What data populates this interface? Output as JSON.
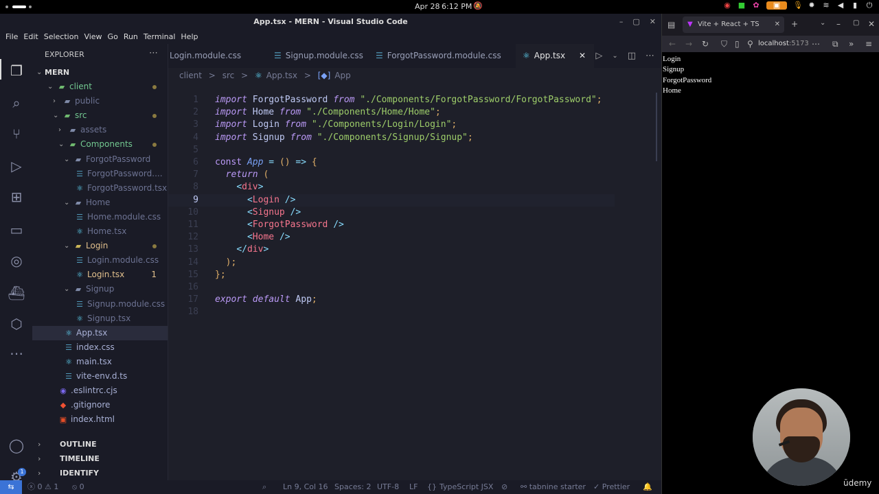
{
  "system": {
    "date": "Apr 28",
    "time": "6:12 PM"
  },
  "vscode": {
    "title": "App.tsx - MERN - Visual Studio Code",
    "menu": [
      "File",
      "Edit",
      "Selection",
      "View",
      "Go",
      "Run",
      "Terminal",
      "Help"
    ],
    "explorer": {
      "title": "EXPLORER",
      "root": "MERN",
      "tree": [
        {
          "label": "client",
          "depth": 1,
          "kind": "folder-open",
          "mod": "dot",
          "color": "green"
        },
        {
          "label": "public",
          "depth": 2,
          "kind": "folder",
          "mod": "",
          "color": "dim"
        },
        {
          "label": "src",
          "depth": 2,
          "kind": "folder-open",
          "mod": "dot",
          "color": "green"
        },
        {
          "label": "assets",
          "depth": 3,
          "kind": "folder",
          "mod": "",
          "color": "dim"
        },
        {
          "label": "Components",
          "depth": 3,
          "kind": "folder-open",
          "mod": "dot",
          "color": "green"
        },
        {
          "label": "ForgotPassword",
          "depth": 4,
          "kind": "folder-open",
          "mod": "",
          "color": "dim"
        },
        {
          "label": "ForgotPassword....",
          "depth": 5,
          "kind": "css",
          "mod": "",
          "color": "dim"
        },
        {
          "label": "ForgotPassword.tsx",
          "depth": 5,
          "kind": "react",
          "mod": "",
          "color": "dim"
        },
        {
          "label": "Home",
          "depth": 4,
          "kind": "folder-open",
          "mod": "",
          "color": "dim"
        },
        {
          "label": "Home.module.css",
          "depth": 5,
          "kind": "css",
          "mod": "",
          "color": "dim"
        },
        {
          "label": "Home.tsx",
          "depth": 5,
          "kind": "react",
          "mod": "",
          "color": "dim"
        },
        {
          "label": "Login",
          "depth": 4,
          "kind": "folder-open",
          "mod": "dot",
          "color": "yellow"
        },
        {
          "label": "Login.module.css",
          "depth": 5,
          "kind": "css",
          "mod": "",
          "color": "dim"
        },
        {
          "label": "Login.tsx",
          "depth": 5,
          "kind": "react",
          "mod": "1",
          "color": "yellow"
        },
        {
          "label": "Signup",
          "depth": 4,
          "kind": "folder-open",
          "mod": "",
          "color": "dim"
        },
        {
          "label": "Signup.module.css",
          "depth": 5,
          "kind": "css",
          "mod": "",
          "color": "dim"
        },
        {
          "label": "Signup.tsx",
          "depth": 5,
          "kind": "react",
          "mod": "",
          "color": "dim"
        },
        {
          "label": "App.tsx",
          "depth": 3,
          "kind": "react",
          "mod": "",
          "color": "normal",
          "selected": true
        },
        {
          "label": "index.css",
          "depth": 3,
          "kind": "css",
          "mod": "",
          "color": "normal"
        },
        {
          "label": "main.tsx",
          "depth": 3,
          "kind": "react",
          "mod": "",
          "color": "normal"
        },
        {
          "label": "vite-env.d.ts",
          "depth": 3,
          "kind": "ts",
          "mod": "",
          "color": "normal"
        },
        {
          "label": ".eslintrc.cjs",
          "depth": 2,
          "kind": "eslint",
          "mod": "",
          "color": "normal"
        },
        {
          "label": ".gitignore",
          "depth": 2,
          "kind": "git",
          "mod": "",
          "color": "normal"
        },
        {
          "label": "index.html",
          "depth": 2,
          "kind": "html",
          "mod": "",
          "color": "normal"
        }
      ],
      "sections": [
        "OUTLINE",
        "TIMELINE",
        "IDENTIFY"
      ]
    },
    "tabs": [
      {
        "label": "Login.module.css",
        "active": false
      },
      {
        "label": "Signup.module.css",
        "active": false
      },
      {
        "label": "ForgotPassword.module.css",
        "active": false
      },
      {
        "label": "App.tsx",
        "active": true
      }
    ],
    "breadcrumb": [
      "client",
      ">",
      "src",
      ">",
      "App.tsx",
      ">",
      "App"
    ],
    "code": [
      "import ForgotPassword from \"./Components/ForgotPassword/ForgotPassword\";",
      "import Home from \"./Components/Home/Home\";",
      "import Login from \"./Components/Login/Login\";",
      "import Signup from \"./Components/Signup/Signup\";",
      "",
      "const App = () => {",
      "  return (",
      "    <div>",
      "      <Login />",
      "      <Signup />",
      "      <ForgotPassword />",
      "      <Home />",
      "    </div>",
      "  );",
      "};",
      "",
      "export default App;",
      ""
    ],
    "current_line": 9,
    "status": {
      "errors": "0",
      "warnings": "1",
      "ports": "0",
      "position": "Ln 9, Col 16",
      "spaces": "Spaces: 2",
      "encoding": "UTF-8",
      "eol": "LF",
      "language": "TypeScript JSX",
      "tabnine": "tabnine starter",
      "prettier": "Prettier"
    },
    "activity_badge": "1"
  },
  "browser": {
    "tab_title": "Vite + React + TS",
    "url_host": "localhost",
    "url_port": ":5173",
    "page_lines": [
      "Login",
      "Signup",
      "ForgotPassword",
      "Home"
    ]
  },
  "overlay": {
    "brand": "ūdemy"
  }
}
